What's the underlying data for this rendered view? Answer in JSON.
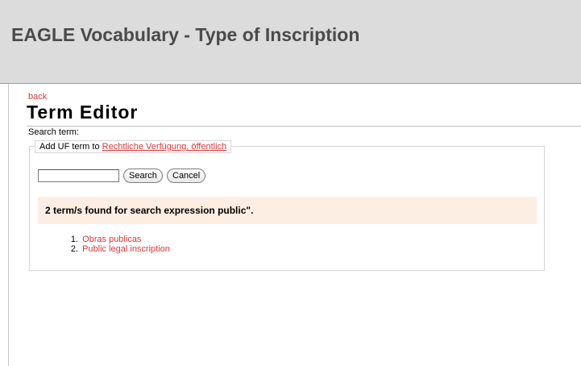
{
  "header": {
    "title": "EAGLE Vocabulary - Type of Inscription"
  },
  "nav": {
    "back_label": "back"
  },
  "page": {
    "title": "Term Editor"
  },
  "search": {
    "label": "Search term:",
    "legend_prefix": "Add UF term to",
    "legend_link": "Rechtliche Verfügung, öffentlich",
    "input_value": "",
    "search_button": "Search",
    "cancel_button": "Cancel"
  },
  "results": {
    "summary": "2 term/s found for search expression public\".",
    "items": [
      {
        "number": "1.",
        "label": "Obras publicas"
      },
      {
        "number": "2.",
        "label": "Public legal inscription"
      }
    ]
  },
  "colors": {
    "header_bg": "#dcdcdc",
    "link": "#d9383a",
    "result_bg": "#fdeee4"
  }
}
